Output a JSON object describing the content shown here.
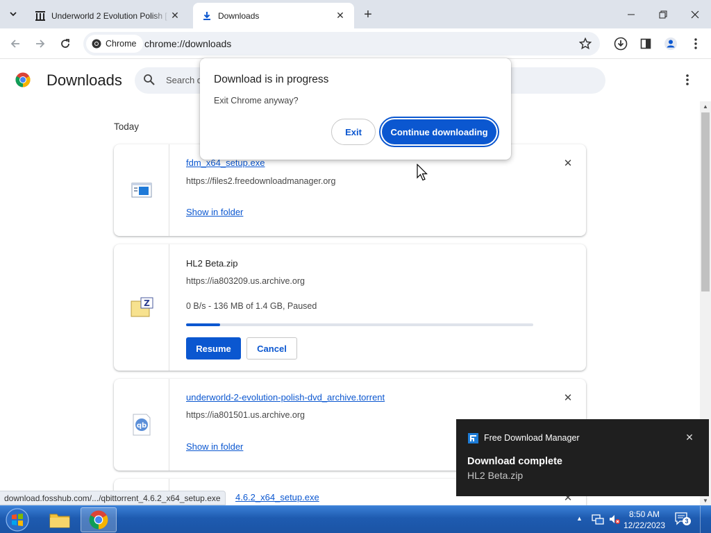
{
  "tabs": [
    {
      "title": "Underworld 2 Evolution Polish [",
      "favicon": "archive-favicon-icon"
    },
    {
      "title": "Downloads",
      "favicon": "download-favicon-icon"
    }
  ],
  "toolbar": {
    "site_chip": "Chrome",
    "url": "chrome://downloads"
  },
  "page": {
    "title": "Downloads",
    "search_placeholder": "Search d",
    "date_group": "Today"
  },
  "downloads": [
    {
      "filename": "fdm_x64_setup.exe",
      "source": "https://files2.freedownloadmanager.org",
      "action": "Show in folder"
    },
    {
      "filename": "HL2 Beta.zip",
      "source": "https://ia803209.us.archive.org",
      "status": "0 B/s - 136 MB of 1.4 GB, Paused",
      "progress_percent": 9.7,
      "resume_label": "Resume",
      "cancel_label": "Cancel"
    },
    {
      "filename": "underworld-2-evolution-polish-dvd_archive.torrent",
      "source": "https://ia801501.us.archive.org",
      "action": "Show in folder"
    },
    {
      "filename": "4.6.2_x64_setup.exe"
    }
  ],
  "dialog": {
    "title": "Download is in progress",
    "body": "Exit Chrome anyway?",
    "exit_label": "Exit",
    "continue_label": "Continue downloading"
  },
  "status_bubble": "download.fosshub.com/.../qbittorrent_4.6.2_x64_setup.exe",
  "notification": {
    "app": "Free Download Manager",
    "headline": "Download complete",
    "body": "HL2 Beta.zip"
  },
  "taskbar": {
    "time": "8:50 AM",
    "date": "12/22/2023",
    "notification_count": "3"
  },
  "colors": {
    "accent": "#0b57d0",
    "tabstrip": "#dee3eb",
    "toast_bg": "#1f1f1f"
  }
}
